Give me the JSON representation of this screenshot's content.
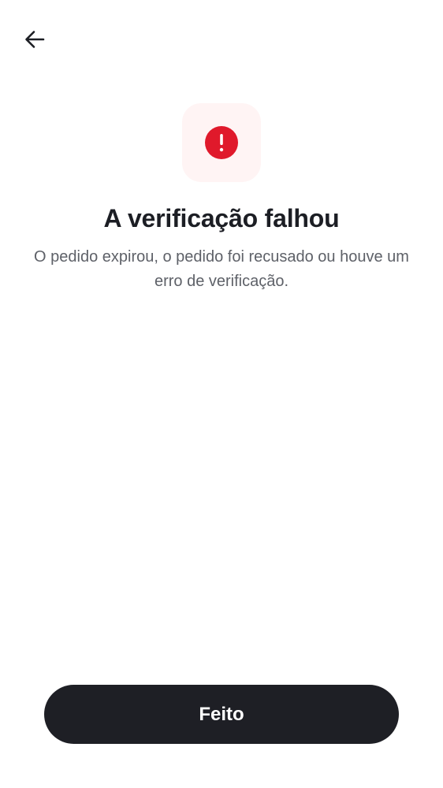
{
  "header": {
    "back_icon": "arrow-left-icon"
  },
  "status": {
    "icon": "alert-circle-icon",
    "tile_color": "#fff4f4",
    "icon_color": "#e0192b"
  },
  "title": "A verificação falhou",
  "description": "O pedido expirou, o pedido foi recusado ou houve um erro de verificação.",
  "actions": {
    "done_label": "Feito",
    "done_color": "#1e1f25"
  }
}
